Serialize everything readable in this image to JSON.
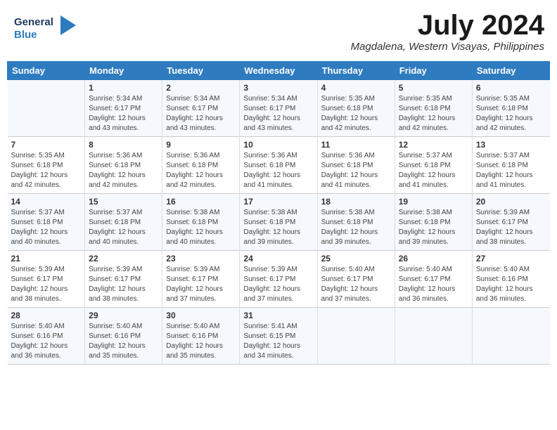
{
  "header": {
    "logo_line1": "General",
    "logo_line2": "Blue",
    "month": "July 2024",
    "location": "Magdalena, Western Visayas, Philippines"
  },
  "days_of_week": [
    "Sunday",
    "Monday",
    "Tuesday",
    "Wednesday",
    "Thursday",
    "Friday",
    "Saturday"
  ],
  "weeks": [
    [
      {
        "day": "",
        "info": ""
      },
      {
        "day": "1",
        "info": "Sunrise: 5:34 AM\nSunset: 6:17 PM\nDaylight: 12 hours\nand 43 minutes."
      },
      {
        "day": "2",
        "info": "Sunrise: 5:34 AM\nSunset: 6:17 PM\nDaylight: 12 hours\nand 43 minutes."
      },
      {
        "day": "3",
        "info": "Sunrise: 5:34 AM\nSunset: 6:17 PM\nDaylight: 12 hours\nand 43 minutes."
      },
      {
        "day": "4",
        "info": "Sunrise: 5:35 AM\nSunset: 6:18 PM\nDaylight: 12 hours\nand 42 minutes."
      },
      {
        "day": "5",
        "info": "Sunrise: 5:35 AM\nSunset: 6:18 PM\nDaylight: 12 hours\nand 42 minutes."
      },
      {
        "day": "6",
        "info": "Sunrise: 5:35 AM\nSunset: 6:18 PM\nDaylight: 12 hours\nand 42 minutes."
      }
    ],
    [
      {
        "day": "7",
        "info": "Sunrise: 5:35 AM\nSunset: 6:18 PM\nDaylight: 12 hours\nand 42 minutes."
      },
      {
        "day": "8",
        "info": "Sunrise: 5:36 AM\nSunset: 6:18 PM\nDaylight: 12 hours\nand 42 minutes."
      },
      {
        "day": "9",
        "info": "Sunrise: 5:36 AM\nSunset: 6:18 PM\nDaylight: 12 hours\nand 42 minutes."
      },
      {
        "day": "10",
        "info": "Sunrise: 5:36 AM\nSunset: 6:18 PM\nDaylight: 12 hours\nand 41 minutes."
      },
      {
        "day": "11",
        "info": "Sunrise: 5:36 AM\nSunset: 6:18 PM\nDaylight: 12 hours\nand 41 minutes."
      },
      {
        "day": "12",
        "info": "Sunrise: 5:37 AM\nSunset: 6:18 PM\nDaylight: 12 hours\nand 41 minutes."
      },
      {
        "day": "13",
        "info": "Sunrise: 5:37 AM\nSunset: 6:18 PM\nDaylight: 12 hours\nand 41 minutes."
      }
    ],
    [
      {
        "day": "14",
        "info": "Sunrise: 5:37 AM\nSunset: 6:18 PM\nDaylight: 12 hours\nand 40 minutes."
      },
      {
        "day": "15",
        "info": "Sunrise: 5:37 AM\nSunset: 6:18 PM\nDaylight: 12 hours\nand 40 minutes."
      },
      {
        "day": "16",
        "info": "Sunrise: 5:38 AM\nSunset: 6:18 PM\nDaylight: 12 hours\nand 40 minutes."
      },
      {
        "day": "17",
        "info": "Sunrise: 5:38 AM\nSunset: 6:18 PM\nDaylight: 12 hours\nand 39 minutes."
      },
      {
        "day": "18",
        "info": "Sunrise: 5:38 AM\nSunset: 6:18 PM\nDaylight: 12 hours\nand 39 minutes."
      },
      {
        "day": "19",
        "info": "Sunrise: 5:38 AM\nSunset: 6:18 PM\nDaylight: 12 hours\nand 39 minutes."
      },
      {
        "day": "20",
        "info": "Sunrise: 5:39 AM\nSunset: 6:17 PM\nDaylight: 12 hours\nand 38 minutes."
      }
    ],
    [
      {
        "day": "21",
        "info": "Sunrise: 5:39 AM\nSunset: 6:17 PM\nDaylight: 12 hours\nand 38 minutes."
      },
      {
        "day": "22",
        "info": "Sunrise: 5:39 AM\nSunset: 6:17 PM\nDaylight: 12 hours\nand 38 minutes."
      },
      {
        "day": "23",
        "info": "Sunrise: 5:39 AM\nSunset: 6:17 PM\nDaylight: 12 hours\nand 37 minutes."
      },
      {
        "day": "24",
        "info": "Sunrise: 5:39 AM\nSunset: 6:17 PM\nDaylight: 12 hours\nand 37 minutes."
      },
      {
        "day": "25",
        "info": "Sunrise: 5:40 AM\nSunset: 6:17 PM\nDaylight: 12 hours\nand 37 minutes."
      },
      {
        "day": "26",
        "info": "Sunrise: 5:40 AM\nSunset: 6:17 PM\nDaylight: 12 hours\nand 36 minutes."
      },
      {
        "day": "27",
        "info": "Sunrise: 5:40 AM\nSunset: 6:16 PM\nDaylight: 12 hours\nand 36 minutes."
      }
    ],
    [
      {
        "day": "28",
        "info": "Sunrise: 5:40 AM\nSunset: 6:16 PM\nDaylight: 12 hours\nand 36 minutes."
      },
      {
        "day": "29",
        "info": "Sunrise: 5:40 AM\nSunset: 6:16 PM\nDaylight: 12 hours\nand 35 minutes."
      },
      {
        "day": "30",
        "info": "Sunrise: 5:40 AM\nSunset: 6:16 PM\nDaylight: 12 hours\nand 35 minutes."
      },
      {
        "day": "31",
        "info": "Sunrise: 5:41 AM\nSunset: 6:15 PM\nDaylight: 12 hours\nand 34 minutes."
      },
      {
        "day": "",
        "info": ""
      },
      {
        "day": "",
        "info": ""
      },
      {
        "day": "",
        "info": ""
      }
    ]
  ]
}
